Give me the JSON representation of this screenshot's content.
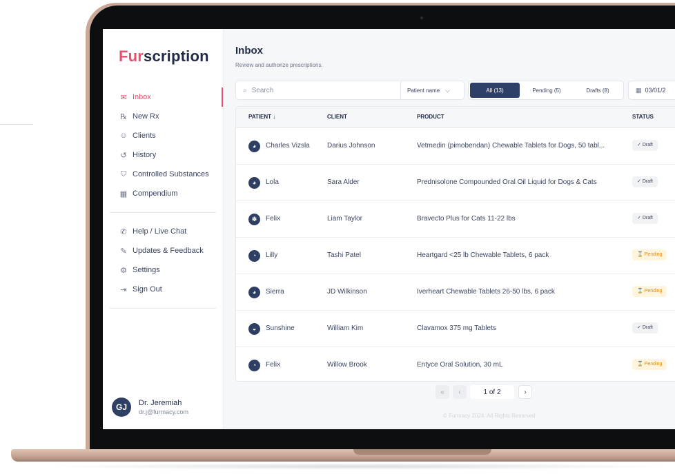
{
  "brand": {
    "prefix": "Fur",
    "suffix": "scription",
    "accent": "#e8506f"
  },
  "sidebar": {
    "primary": [
      {
        "label": "Inbox",
        "icon": "inbox-icon",
        "glyph": "✉",
        "active": true
      },
      {
        "label": "New Rx",
        "icon": "rx-icon",
        "glyph": "℞"
      },
      {
        "label": "Clients",
        "icon": "clients-icon",
        "glyph": "☺"
      },
      {
        "label": "History",
        "icon": "history-icon",
        "glyph": "↺"
      },
      {
        "label": "Controlled Substances",
        "icon": "shield-icon",
        "glyph": "⛉"
      },
      {
        "label": "Compendium",
        "icon": "compendium-icon",
        "glyph": "▦"
      }
    ],
    "secondary": [
      {
        "label": "Help / Live Chat",
        "icon": "chat-icon",
        "glyph": "✆"
      },
      {
        "label": "Updates & Feedback",
        "icon": "feedback-icon",
        "glyph": "✎"
      },
      {
        "label": "Settings",
        "icon": "settings-icon",
        "glyph": "⚙"
      },
      {
        "label": "Sign Out",
        "icon": "sign-out-icon",
        "glyph": "⇥"
      }
    ]
  },
  "user": {
    "initials": "GJ",
    "name": "Dr. Jeremiah",
    "email": "dr.j@furmacy.com"
  },
  "header": {
    "title": "Inbox",
    "subtitle": "Review and authorize prescriptions."
  },
  "filters": {
    "search_placeholder": "Search",
    "patient_select": "Patient name",
    "tabs": [
      {
        "label": "All (13)",
        "active": true
      },
      {
        "label": "Pending (5)"
      },
      {
        "label": "Drafts (8)"
      }
    ],
    "date": "03/01/2"
  },
  "table": {
    "columns": {
      "patient": "PATIENT ↓",
      "client": "CLIENT",
      "product": "PRODUCT",
      "status": "STATUS"
    },
    "rows": [
      {
        "patient": "Charles Vizsla",
        "client": "Darius Johnson",
        "product": "Vetmedin (pimobendan) Chewable Tablets for Dogs, 50 tabl...",
        "status": "Draft",
        "pet_icon": "dog-icon"
      },
      {
        "patient": "Lola",
        "client": "Sara Alder",
        "product": "Prednisolone Compounded Oral Oil Liquid for Dogs & Cats",
        "status": "Draft",
        "pet_icon": "dog-icon"
      },
      {
        "patient": "Felix",
        "client": "Liam Taylor",
        "product": "Bravecto Plus for Cats 11-22 lbs",
        "status": "Draft",
        "pet_icon": "paw-icon"
      },
      {
        "patient": "Lilly",
        "client": "Tashi Patel",
        "product": "Heartgard <25 lb Chewable Tablets, 6 pack",
        "status": "Pending",
        "pet_icon": "cat-icon"
      },
      {
        "patient": "Sierra",
        "client": "JD Wilkinson",
        "product": "Iverheart Chewable Tablets 26-50 lbs, 6 pack",
        "status": "Pending",
        "pet_icon": "dog-icon"
      },
      {
        "patient": "Sunshine",
        "client": "William Kim",
        "product": "Clavamox 375 mg Tablets",
        "status": "Draft",
        "pet_icon": "bird-icon"
      },
      {
        "patient": "Felix",
        "client": "Willow Brook",
        "product": "Entyce Oral Solution, 30 mL",
        "status": "Pending",
        "pet_icon": "cat-icon"
      }
    ]
  },
  "pagination": {
    "first": "«",
    "prev": "‹",
    "info": "1 of 2",
    "next": "›"
  },
  "footer": "© Furmacy 2024. All Rights Reserved",
  "status_icons": {
    "Draft": "✓",
    "Pending": "⌛"
  }
}
